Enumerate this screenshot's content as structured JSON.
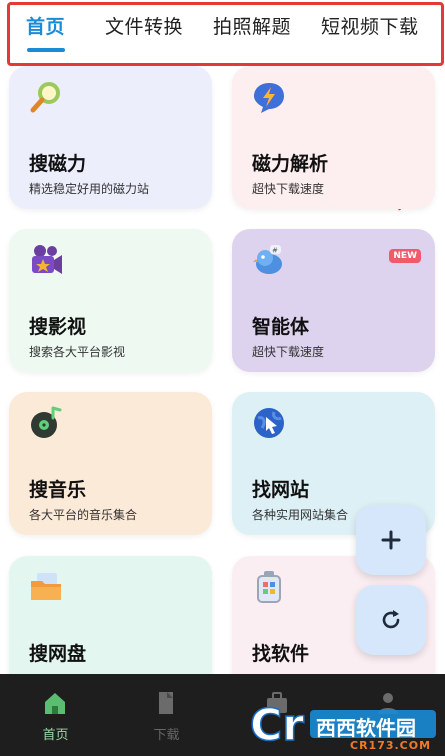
{
  "tabs": [
    {
      "label": "首页",
      "active": true
    },
    {
      "label": "文件转换",
      "active": false
    },
    {
      "label": "拍照解题",
      "active": false
    },
    {
      "label": "短视频下载",
      "active": false
    }
  ],
  "cards": [
    {
      "title": "搜磁力",
      "subtitle": "精选稳定好用的磁力站",
      "icon": "magnifier-icon",
      "bg": "#eceefc"
    },
    {
      "title": "磁力解析",
      "subtitle": "超快下载速度",
      "icon": "lightning-chat-icon",
      "bg": "#fdeef0"
    },
    {
      "title": "搜影视",
      "subtitle": "搜索各大平台影视",
      "icon": "film-camera-icon",
      "bg": "#eef9f1"
    },
    {
      "title": "智能体",
      "subtitle": "超快下载速度",
      "icon": "bird-chat-icon",
      "bg": "#ddd3ef",
      "badge": "NEW"
    },
    {
      "title": "搜音乐",
      "subtitle": "各大平台的音乐集合",
      "icon": "music-disc-icon",
      "bg": "#fcead8"
    },
    {
      "title": "找网站",
      "subtitle": "各种实用网站集合",
      "icon": "globe-cursor-icon",
      "bg": "#ddf0f5"
    },
    {
      "title": "搜网盘",
      "subtitle": "",
      "icon": "folder-icon",
      "bg": "#e3f6ef"
    },
    {
      "title": "找软件",
      "subtitle": "",
      "icon": "app-box-icon",
      "bg": "#fbeef3"
    }
  ],
  "fabs": {
    "add_icon": "plus-icon",
    "refresh_icon": "refresh-icon"
  },
  "bottom_nav": [
    {
      "label": "首页",
      "icon": "home-icon",
      "active": true
    },
    {
      "label": "下载",
      "icon": "download-icon",
      "active": false
    },
    {
      "label": "",
      "icon": "toolbox-icon",
      "active": false
    },
    {
      "label": "",
      "icon": "profile-icon",
      "active": false
    }
  ],
  "watermark": {
    "brand": "西西软件园",
    "url": "CR173.COM"
  },
  "colors": {
    "accent": "#1a8bd6",
    "annotation": "#e53935",
    "nav_bg": "#1e1e1e"
  }
}
